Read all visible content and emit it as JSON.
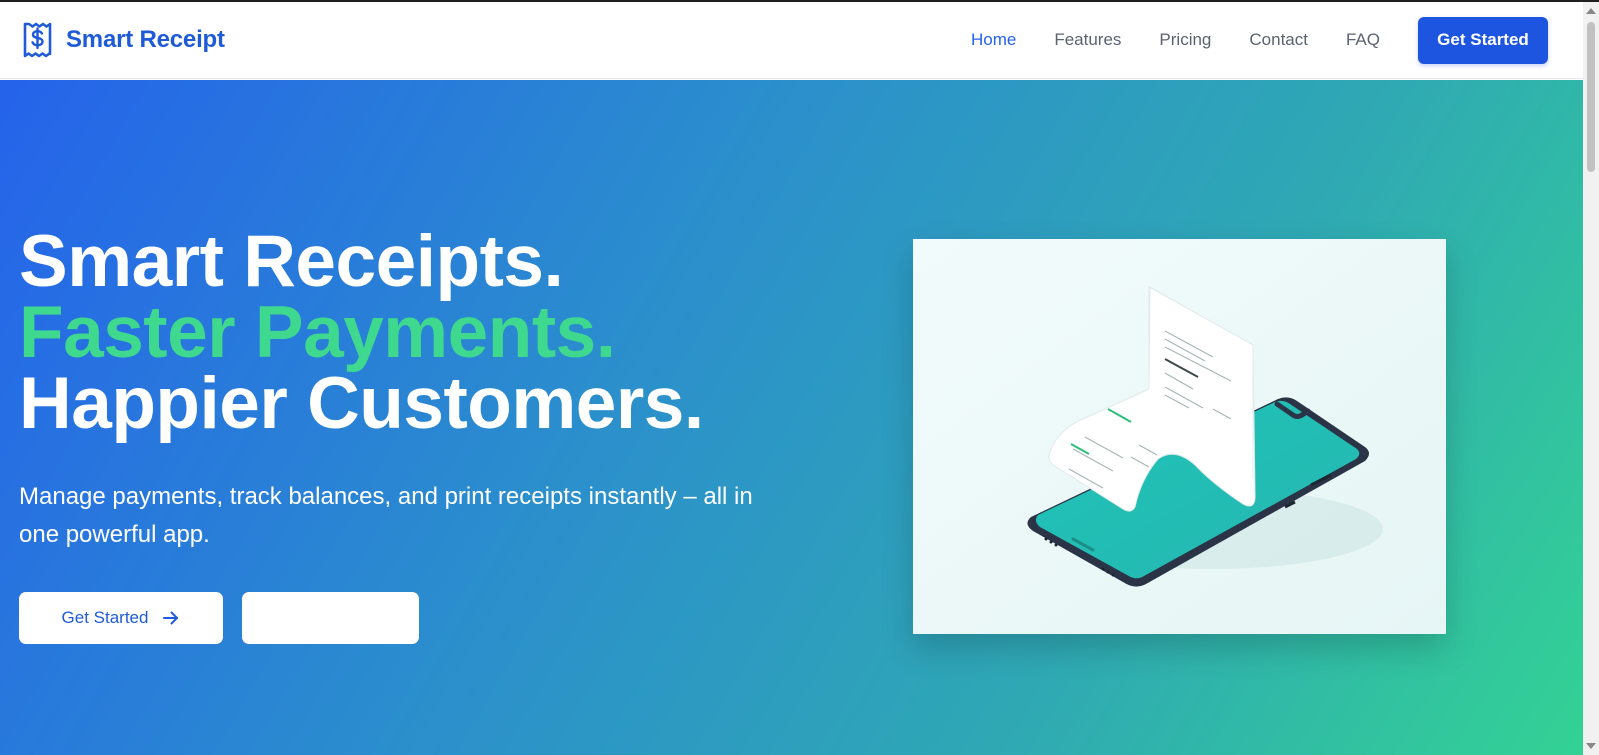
{
  "brand": {
    "name": "Smart Receipt",
    "logo_icon": "receipt-dollar-icon"
  },
  "nav": {
    "items": [
      {
        "label": "Home",
        "active": true
      },
      {
        "label": "Features",
        "active": false
      },
      {
        "label": "Pricing",
        "active": false
      },
      {
        "label": "Contact",
        "active": false
      },
      {
        "label": "FAQ",
        "active": false
      }
    ],
    "cta_label": "Get Started"
  },
  "hero": {
    "line1": "Smart Receipts.",
    "line2": "Faster Payments.",
    "line3": "Happier Customers.",
    "subtitle": "Manage payments, track balances, and print receipts instantly – all in one powerful app.",
    "primary_button": {
      "label": "Get Started",
      "icon": "arrow-right-icon"
    },
    "secondary_button": {
      "label": ""
    },
    "image_alt": "phone-printing-receipt-illustration"
  },
  "colors": {
    "brand": "#1f5bd8",
    "accent_green": "#3ed88e",
    "gradient_start": "#2563eb",
    "gradient_end": "#33d294"
  }
}
